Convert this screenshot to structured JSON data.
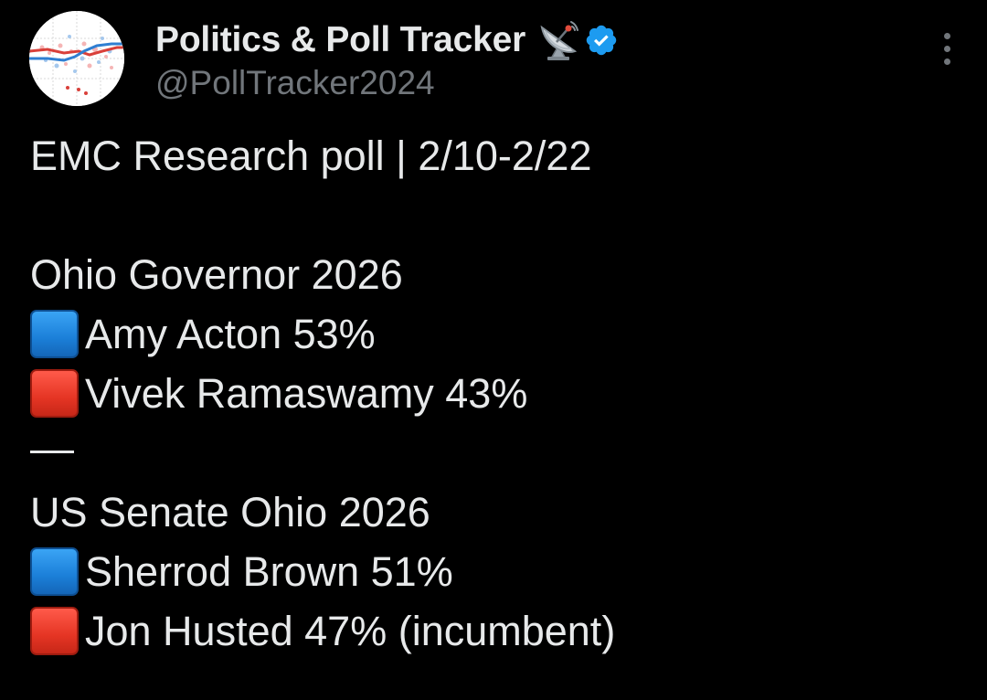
{
  "author": {
    "display_name": "Politics & Poll Tracker",
    "handle": "@PollTracker2024",
    "name_emoji": "satellite-antenna-icon",
    "verified": true,
    "verified_color": "#1d9bf0"
  },
  "colors": {
    "background": "#000000",
    "text": "#e7e9ea",
    "secondary_text": "#71767b",
    "democrat_square": "#1b7fd8",
    "republican_square": "#e53524"
  },
  "tweet": {
    "headline": "EMC Research poll | 2/10-2/22",
    "races": [
      {
        "title": "Ohio Governor 2026",
        "candidates": [
          {
            "marker": "blue-square-icon",
            "text": "Amy Acton 53%"
          },
          {
            "marker": "red-square-icon",
            "text": "Vivek Ramaswamy 43%"
          }
        ]
      },
      {
        "title": "US Senate Ohio 2026",
        "candidates": [
          {
            "marker": "blue-square-icon",
            "text": "Sherrod Brown 51%"
          },
          {
            "marker": "red-square-icon",
            "text": "Jon Husted 47% (incumbent)"
          }
        ]
      }
    ],
    "separator": "—"
  }
}
